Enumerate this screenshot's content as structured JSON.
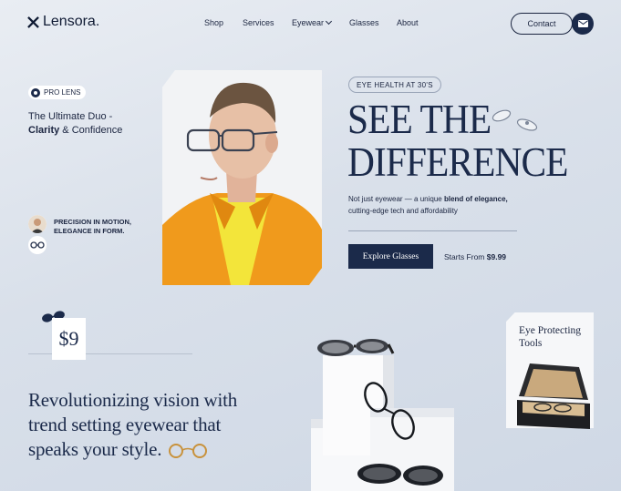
{
  "brand": {
    "name": "Lensora."
  },
  "nav": {
    "items": [
      "Shop",
      "Services",
      "Eyewear",
      "Glasses",
      "About"
    ],
    "contact_label": "Contact",
    "mail_icon": "mail-icon"
  },
  "left": {
    "pill_label": "PRO LENS",
    "duo_line1": "The Ultimate Duo -",
    "duo_bold": "Clarity",
    "duo_rest": " & Confidence",
    "precision_text": "PRECISION IN MOTION, ELEGANCE IN FORM."
  },
  "hero": {
    "tag": "EYE HEALTH AT 30'S",
    "title_line1": "SEE THE",
    "title_line2": "DIFFERENCE",
    "sub_a": "Not just eyewear — a unique ",
    "sub_bold": "blend of elegance,",
    "sub_b": "cutting-edge tech and  affordability",
    "cta_label": "Explore Glasses",
    "starts_label": "Starts From ",
    "starts_price": "$9.99"
  },
  "lower": {
    "price": "$9",
    "headline": "Revolutionizing vision with trend setting eyewear that speaks your style.",
    "tools_title": "Eye Protecting Tools"
  },
  "colors": {
    "accent": "#1b2a4a",
    "background": "#dfe5ee"
  }
}
